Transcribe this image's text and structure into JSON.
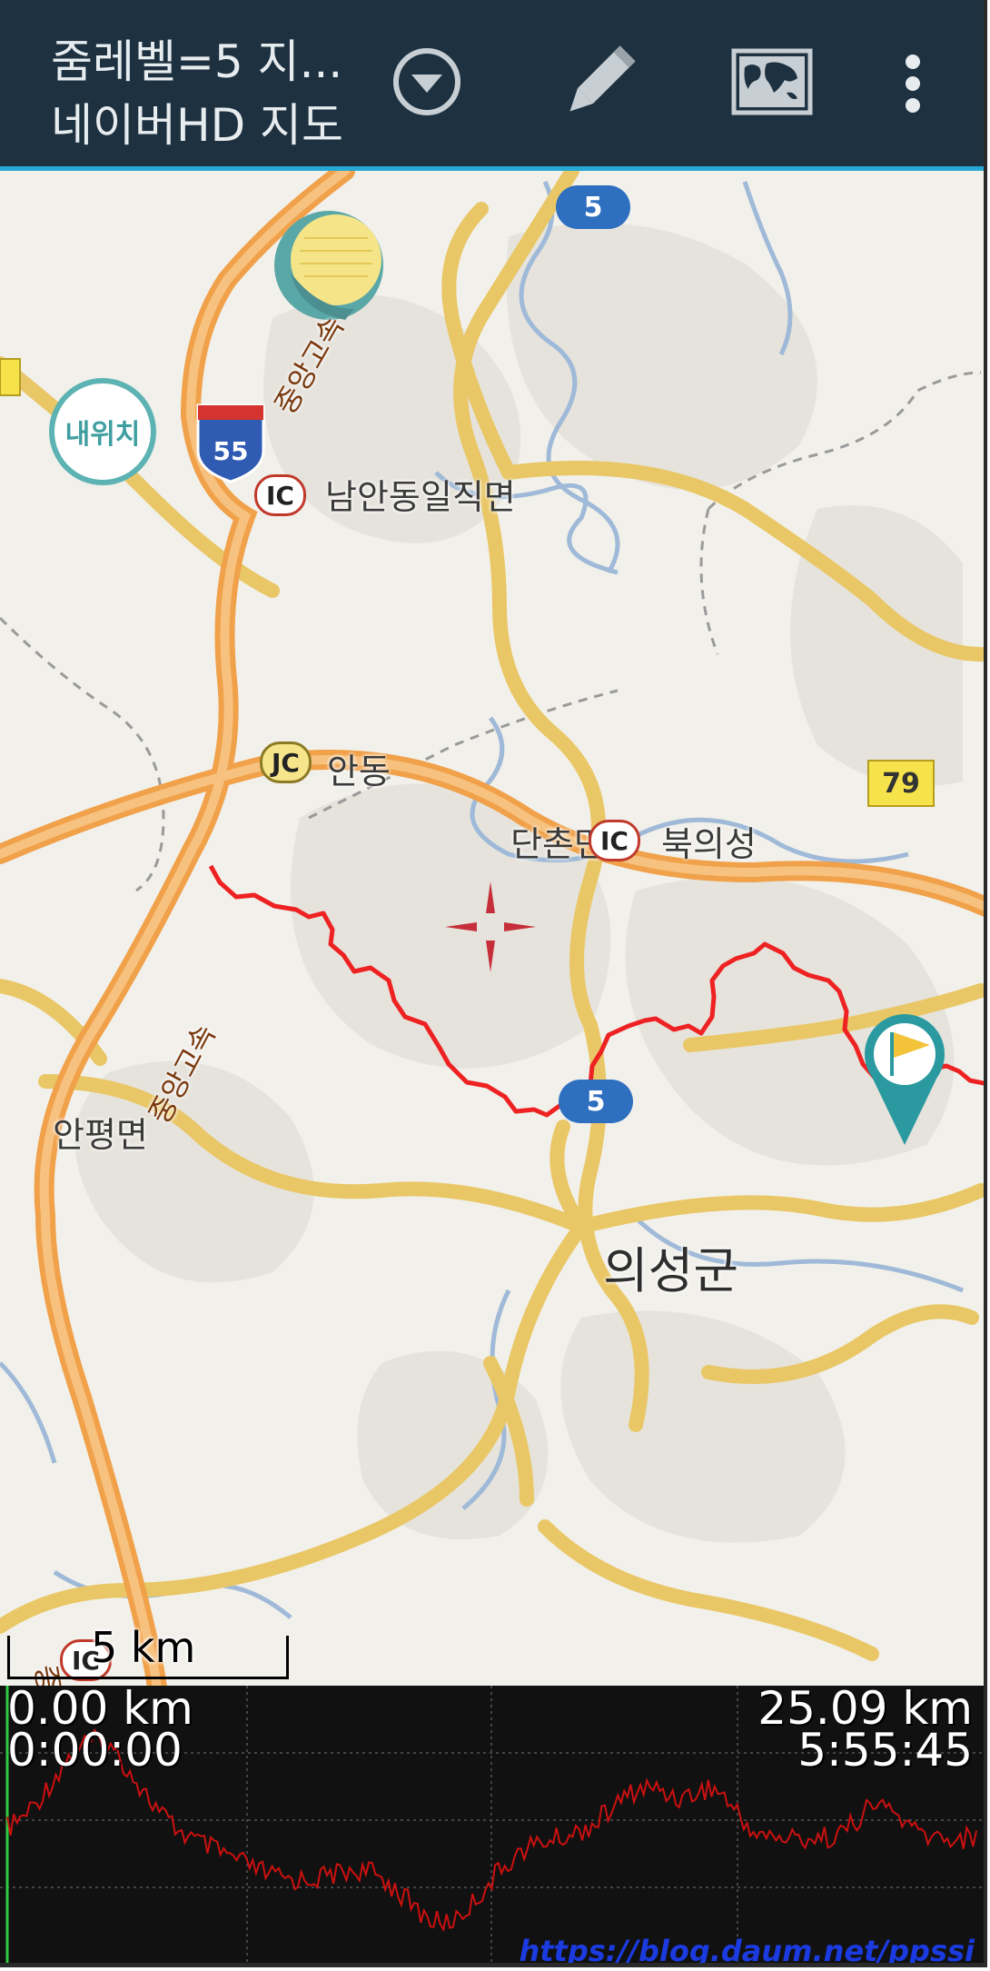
{
  "appbar": {
    "title_line1": "줌레벨=5 지...",
    "title_line2": "네이버HD 지도",
    "icons": [
      "dropdown-circle-icon",
      "pencil-icon",
      "world-map-icon",
      "more-vert-icon"
    ],
    "background": "#1d3140",
    "accent": "#27a7d3"
  },
  "map": {
    "my_location_label": "내위치",
    "places": {
      "namandong": "남안동일직면",
      "andong": "안동",
      "danchon": "단촌면",
      "bukuiseong": "북의성",
      "anpyeong": "안평면",
      "uiseong": "의성군"
    },
    "badges": {
      "ic": "IC",
      "jc": "JC"
    },
    "shields": {
      "route5": "5",
      "route55": "55",
      "route79": "79"
    },
    "expressway_names": [
      "중앙고속",
      "중앙고속"
    ],
    "scale_label": "5 km",
    "track_color": "#ee2222"
  },
  "elevation": {
    "start_distance": "0.00 km",
    "start_time": "0:00:00",
    "end_distance": "25.09 km",
    "end_time": "5:55:45",
    "line_color": "#cc1010"
  },
  "watermark": "https://blog.daum.net/ppssi"
}
